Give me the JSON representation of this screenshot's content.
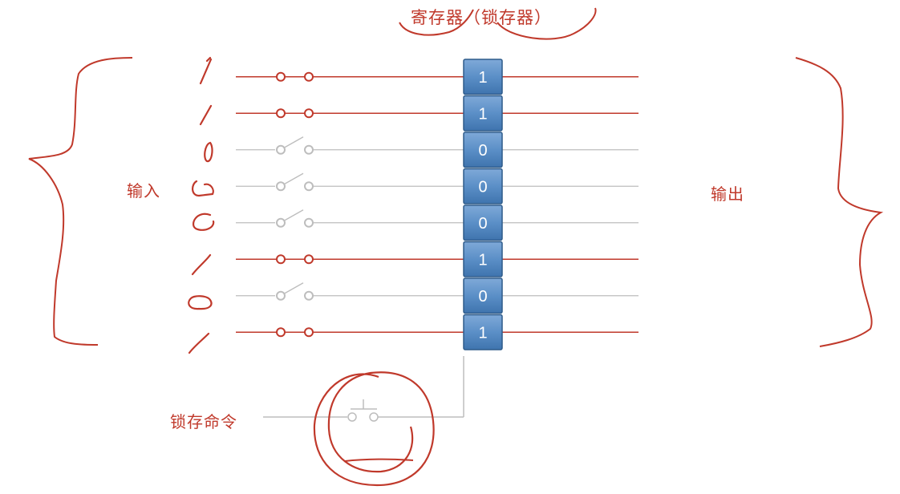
{
  "title": "寄存器（锁存器）",
  "input_label": "输入",
  "output_label": "输出",
  "latch_command_label": "锁存命令",
  "bits": [
    "1",
    "1",
    "0",
    "0",
    "0",
    "1",
    "0",
    "1"
  ],
  "colors": {
    "red": "#c0392b",
    "gray": "#bdbdbd",
    "cell_fill": "#5b8fc7",
    "cell_border": "#2e5b8a",
    "cell_text": "#ffffff"
  }
}
